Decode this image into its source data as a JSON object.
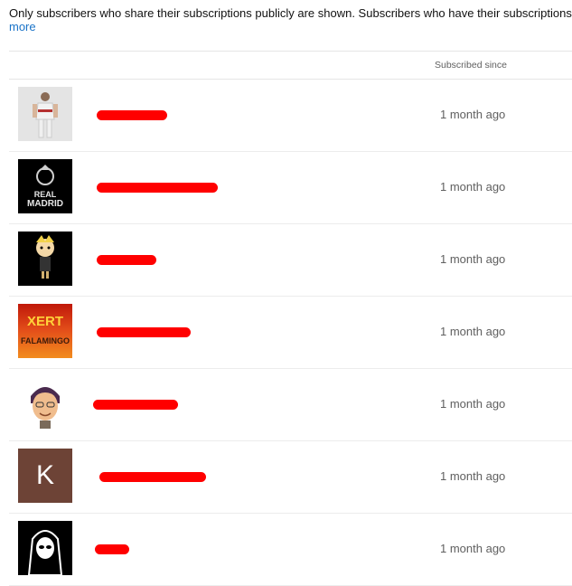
{
  "notice": {
    "text": "Only subscribers who share their subscriptions publicly are shown. Subscribers who have their subscriptions",
    "more_label": "more"
  },
  "table": {
    "header_since": "Subscribed since"
  },
  "rows": [
    {
      "name": "",
      "since": "1 month ago",
      "avatar": "soccer-player-photo"
    },
    {
      "name": "",
      "since": "1 month ago",
      "avatar": "real-madrid-logo",
      "avatar_text": "REAL MADRID"
    },
    {
      "name": "",
      "since": "1 month ago",
      "avatar": "cartoon-character"
    },
    {
      "name": "",
      "since": "1 month ago",
      "avatar": "fire-text-logo",
      "avatar_text": "XERT FALAMINGO"
    },
    {
      "name": "",
      "since": "1 month ago",
      "avatar": "bitmoji-avatar"
    },
    {
      "name": "",
      "since": "1 month ago",
      "avatar": "letter-avatar",
      "avatar_letter": "K",
      "avatar_color": "#6d4336"
    },
    {
      "name": "",
      "since": "1 month ago",
      "avatar": "hooded-figure"
    }
  ],
  "colors": {
    "link": "#1a73c8",
    "redaction": "#ff0000"
  }
}
